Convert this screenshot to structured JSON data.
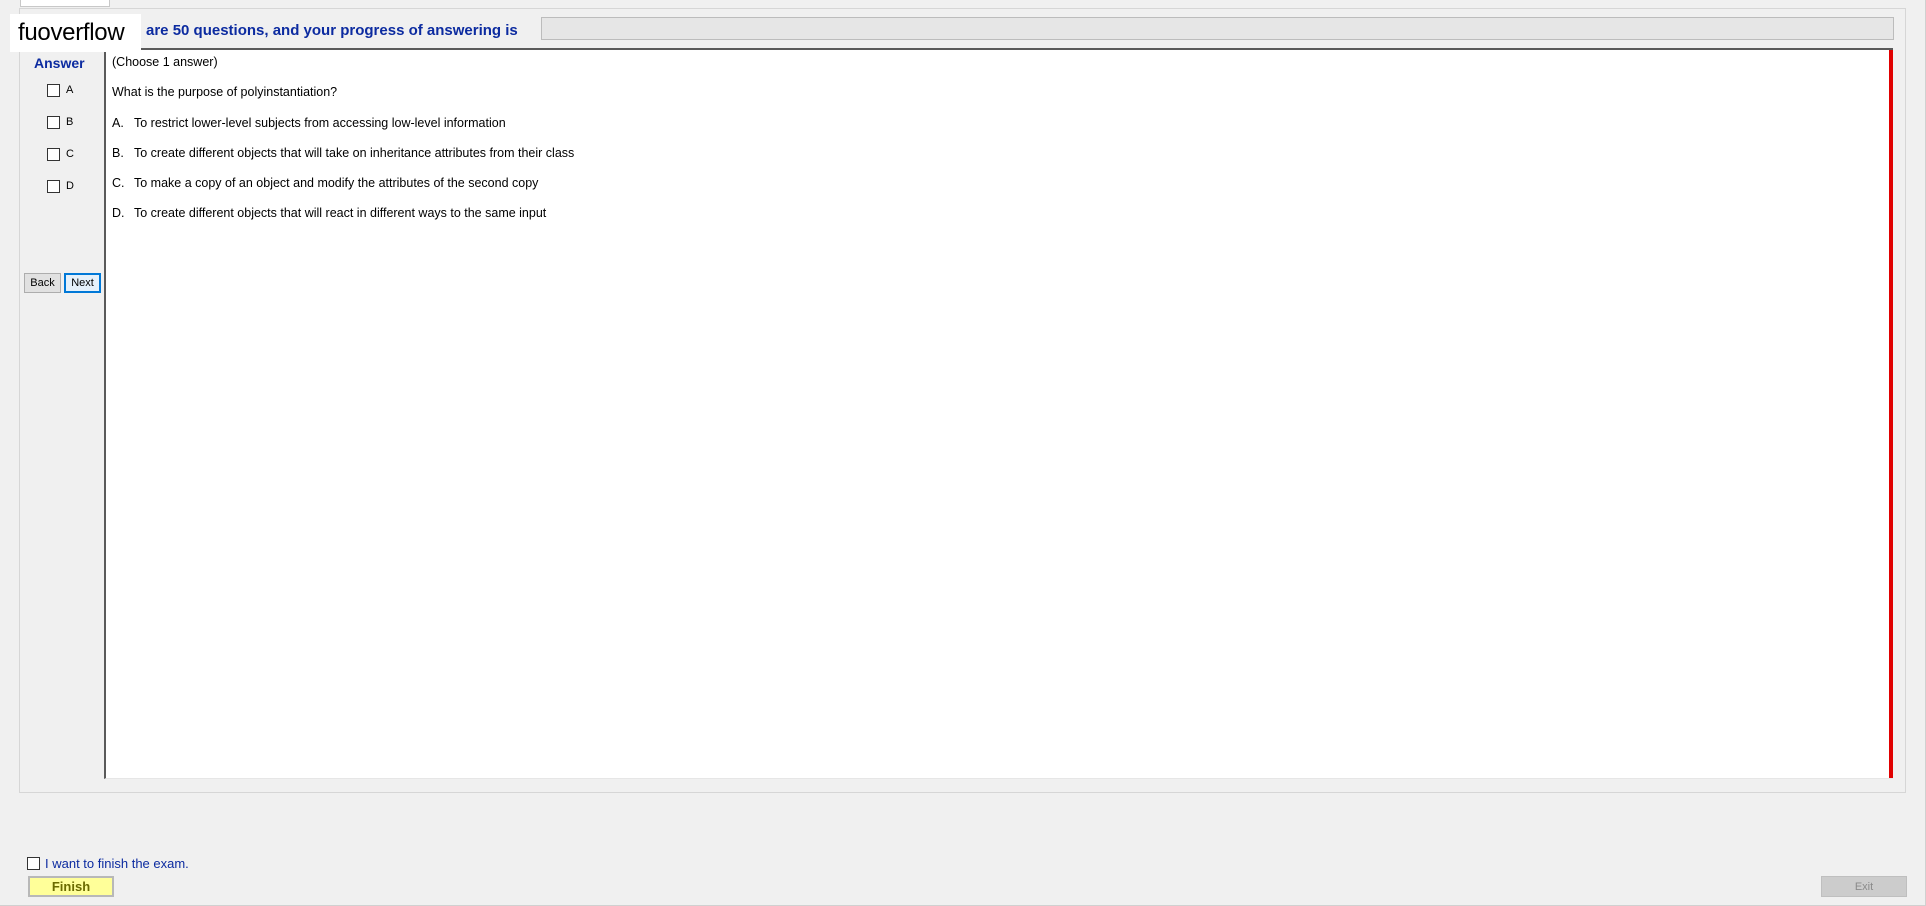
{
  "header": {
    "logo_text": "fuoverflow",
    "progress_caption": "are 50 questions, and your progress of answering is",
    "progress_value": 0
  },
  "answer_panel": {
    "heading": "Answer",
    "options": [
      {
        "letter": "A"
      },
      {
        "letter": "B"
      },
      {
        "letter": "C"
      },
      {
        "letter": "D"
      }
    ],
    "back_label": "Back",
    "next_label": "Next"
  },
  "question": {
    "instruction": "(Choose 1 answer)",
    "text": "What is the purpose of polyinstantiation?",
    "options": [
      {
        "letter": "A.",
        "text": "To restrict lower-level subjects from accessing low-level information"
      },
      {
        "letter": "B.",
        "text": "To create different objects that will take on inheritance attributes from their class"
      },
      {
        "letter": "C.",
        "text": "To make a copy of an object and modify the attributes of the second copy"
      },
      {
        "letter": "D.",
        "text": "To create different objects that will react in different ways to the same input"
      }
    ]
  },
  "footer": {
    "finish_checkbox_label": "I want to finish the exam.",
    "finish_label": "Finish",
    "exit_label": "Exit"
  },
  "colors": {
    "accent_text": "#0c2ba0",
    "finish_bg": "#ffff99",
    "scroll_marker": "#e00000"
  }
}
